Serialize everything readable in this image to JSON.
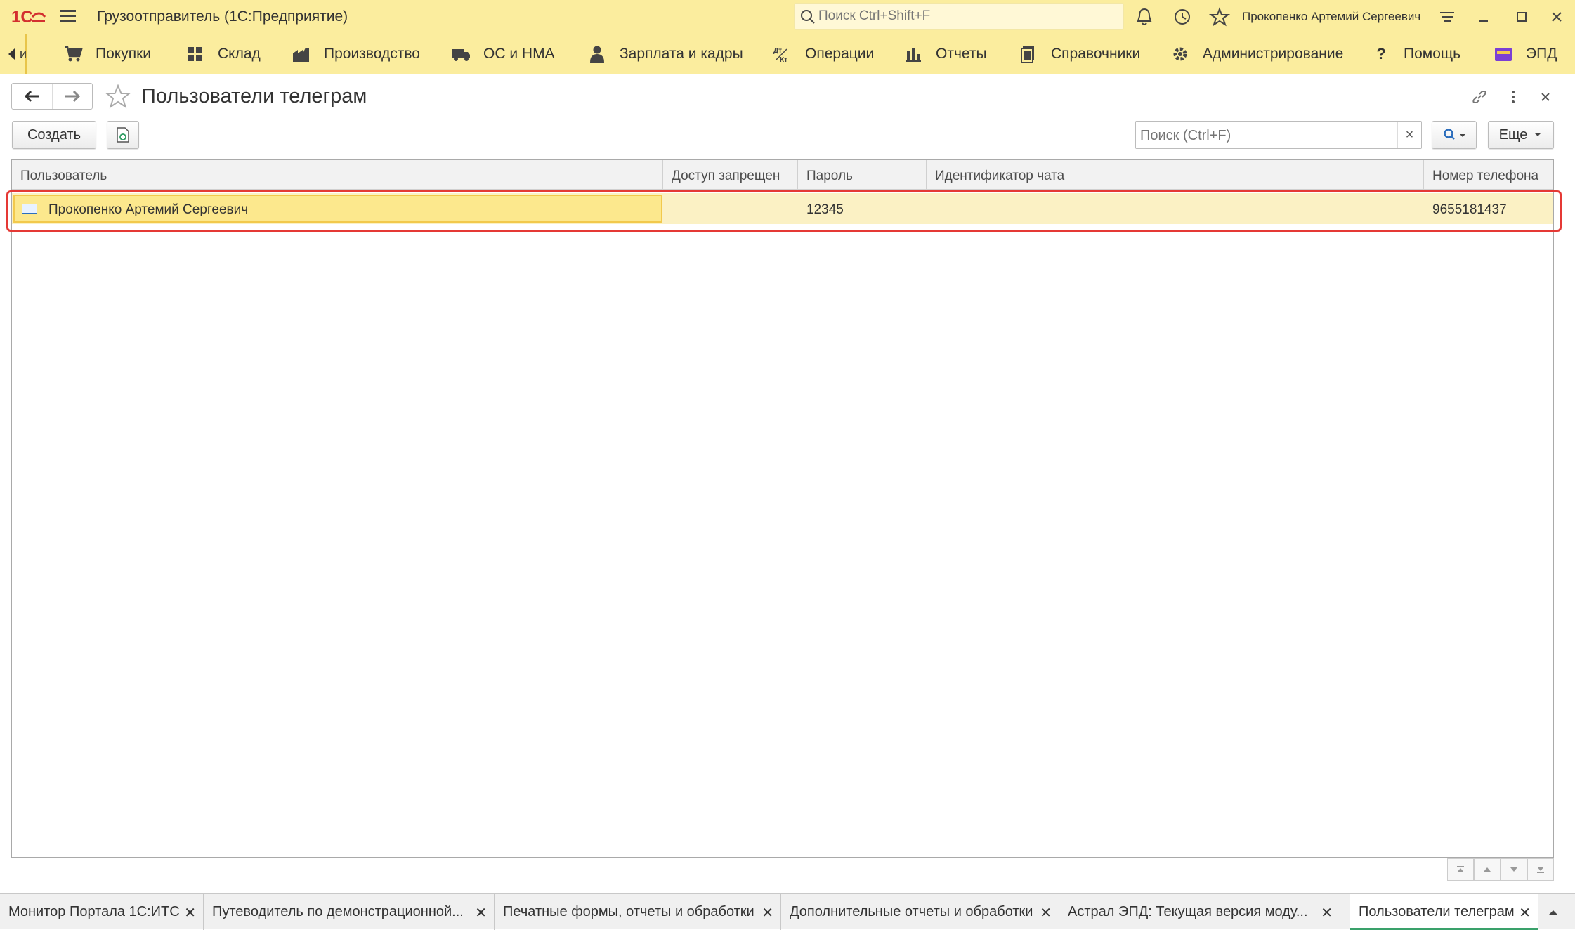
{
  "app": {
    "title": "Грузоотправитель  (1С:Предприятие)",
    "search_placeholder": "Поиск Ctrl+Shift+F",
    "user": "Прокопенко Артемий Сергеевич",
    "logo_text": "1С"
  },
  "sections": {
    "left_fragment": "и",
    "items": [
      {
        "label": "Покупки",
        "icon": "cart-icon"
      },
      {
        "label": "Склад",
        "icon": "warehouse-icon"
      },
      {
        "label": "Производство",
        "icon": "factory-icon"
      },
      {
        "label": "ОС и НМА",
        "icon": "truck-icon"
      },
      {
        "label": "Зарплата и кадры",
        "icon": "person-icon"
      },
      {
        "label": "Операции",
        "icon": "operations-icon"
      },
      {
        "label": "Отчеты",
        "icon": "bar-chart-icon"
      },
      {
        "label": "Справочники",
        "icon": "books-icon"
      },
      {
        "label": "Администрирование",
        "icon": "gear-icon"
      },
      {
        "label": "Помощь",
        "icon": "question-icon"
      },
      {
        "label": "ЭПД",
        "icon": "folder-icon"
      }
    ]
  },
  "form": {
    "title": "Пользователи телеграм",
    "create_label": "Создать",
    "search_placeholder": "Поиск (Ctrl+F)",
    "clear_label": "×",
    "more_label": "Еще"
  },
  "table": {
    "columns": [
      "Пользователь",
      "Доступ запрещен",
      "Пароль",
      "Идентификатор чата",
      "Номер телефона"
    ],
    "rows": [
      {
        "user": "Прокопенко Артемий Сергеевич",
        "access_denied": "",
        "password": "12345",
        "chat_id": "",
        "phone": "9655181437"
      }
    ]
  },
  "tabs": [
    {
      "label": "Монитор Портала 1С:ИТС"
    },
    {
      "label": "Путеводитель по демонстрационной..."
    },
    {
      "label": "Печатные формы, отчеты и обработки"
    },
    {
      "label": "Дополнительные отчеты и обработки"
    },
    {
      "label": "Астрал ЭПД: Текущая версия моду..."
    },
    {
      "label": "Пользователи телеграм",
      "active": true
    }
  ],
  "colors": {
    "titlebar": "#fbed9e",
    "selected_row": "#fbf1c4",
    "highlight": "#e53935",
    "logo_red": "#d32f2f"
  }
}
